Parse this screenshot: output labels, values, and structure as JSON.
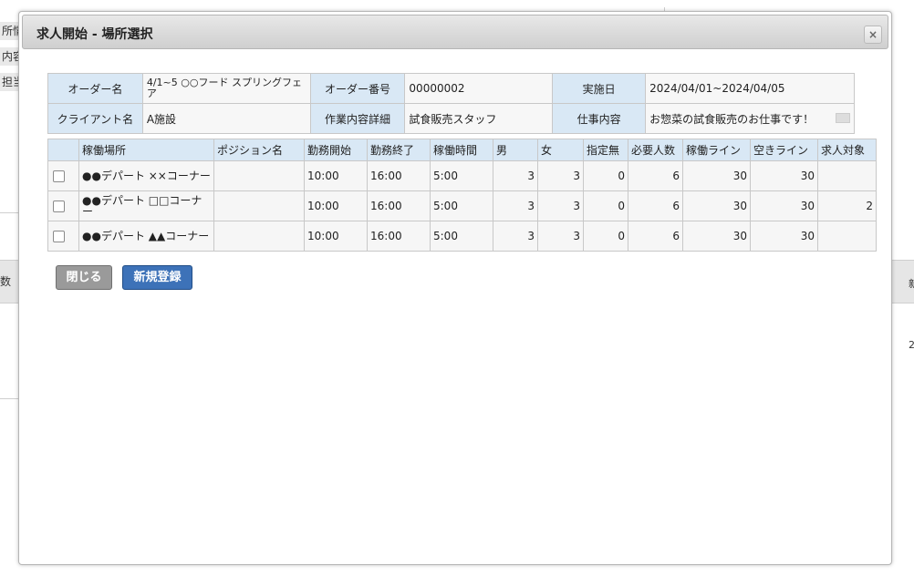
{
  "background": {
    "left_fragments": [
      "所情",
      "内容",
      "担当"
    ],
    "left_band_label": "数",
    "right_band_label": "新",
    "right_value": "2"
  },
  "dialog": {
    "title": "求人開始 - 場所選択",
    "close_icon": "×"
  },
  "info": {
    "order_name_label": "オーダー名",
    "order_name_value": "4/1~5 ○○フード スプリングフェア",
    "order_no_label": "オーダー番号",
    "order_no_value": "00000002",
    "date_label": "実施日",
    "date_value": "2024/04/01~2024/04/05",
    "client_label": "クライアント名",
    "client_value": "A施設",
    "work_detail_label": "作業内容詳細",
    "work_detail_value": "試食販売スタッフ",
    "job_label": "仕事内容",
    "job_value": "お惣菜の試食販売のお仕事です！"
  },
  "grid": {
    "headers": [
      "",
      "稼働場所",
      "ポジション名",
      "勤務開始",
      "勤務終了",
      "稼働時間",
      "男",
      "女",
      "指定無",
      "必要人数",
      "稼働ライン",
      "空きライン",
      "求人対象"
    ],
    "rows": [
      {
        "place": "●●デパート ××コーナー",
        "position": "",
        "start": "10:00",
        "end": "16:00",
        "hours": "5:00",
        "male": "3",
        "female": "3",
        "any": "0",
        "required": "6",
        "line": "30",
        "free": "30",
        "target": ""
      },
      {
        "place": "●●デパート □□コーナー",
        "position": "",
        "start": "10:00",
        "end": "16:00",
        "hours": "5:00",
        "male": "3",
        "female": "3",
        "any": "0",
        "required": "6",
        "line": "30",
        "free": "30",
        "target": "2"
      },
      {
        "place": "●●デパート ▲▲コーナー",
        "position": "",
        "start": "10:00",
        "end": "16:00",
        "hours": "5:00",
        "male": "3",
        "female": "3",
        "any": "0",
        "required": "6",
        "line": "30",
        "free": "30",
        "target": ""
      }
    ]
  },
  "buttons": {
    "close_label": "閉じる",
    "new_label": "新規登録"
  },
  "colors": {
    "header_bg": "#d9e8f5",
    "primary_button": "#3d72b8",
    "secondary_button": "#9a9a9a"
  }
}
